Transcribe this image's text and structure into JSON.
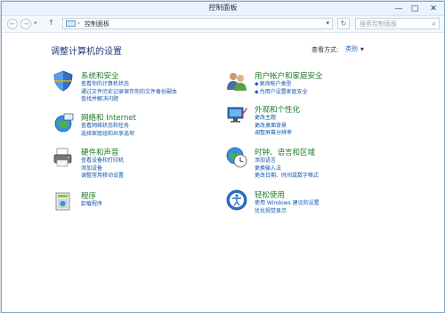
{
  "window": {
    "title": "控制面板"
  },
  "window_buttons": {
    "minimize": "—",
    "maximize": "□",
    "close": "✕"
  },
  "nav": {
    "back": "←",
    "forward": "→",
    "history": "▾",
    "up": "↑",
    "address_separator": "›",
    "address": "控制面板",
    "address_dropdown": "▾",
    "refresh": "↻",
    "search_placeholder": "搜索控制面板",
    "search_icon": "⌕"
  },
  "main": {
    "heading": "调整计算机的设置",
    "view_by_label": "查看方式:",
    "view_by_value": "类别",
    "view_by_chevron": "▼"
  },
  "categories": [
    {
      "title": "系统和安全",
      "icon": "shield-icon",
      "links": [
        "查看你的计算机状态",
        "通过文件历史记录保存你的文件备份副本",
        "查找并解决问题"
      ]
    },
    {
      "title": "网络和 Internet",
      "icon": "globe-network-icon",
      "links": [
        "查看网络状态和任务",
        "选择家庭组和共享选项"
      ]
    },
    {
      "title": "硬件和声音",
      "icon": "printer-icon",
      "links": [
        "查看设备和打印机",
        "添加设备",
        "调整常用移动设置"
      ]
    },
    {
      "title": "程序",
      "icon": "programs-icon",
      "links": [
        "卸载程序"
      ]
    },
    {
      "title": "用户帐户和家庭安全",
      "icon": "users-icon",
      "links": [
        "更改帐户类型",
        "为用户设置家庭安全"
      ]
    },
    {
      "title": "外观和个性化",
      "icon": "personalization-icon",
      "links": [
        "更改主题",
        "更改桌面背景",
        "调整屏幕分辨率"
      ]
    },
    {
      "title": "时钟、语言和区域",
      "icon": "clock-globe-icon",
      "links": [
        "添加语言",
        "更换输入法",
        "更改日期、时间或数字格式"
      ]
    },
    {
      "title": "轻松使用",
      "icon": "ease-of-access-icon",
      "links": [
        "使用 Windows 建议的设置",
        "优化视觉显示"
      ]
    }
  ],
  "colors": {
    "category_title": "#1b7a27",
    "link": "#1155aa",
    "heading": "#1e3b7a"
  }
}
